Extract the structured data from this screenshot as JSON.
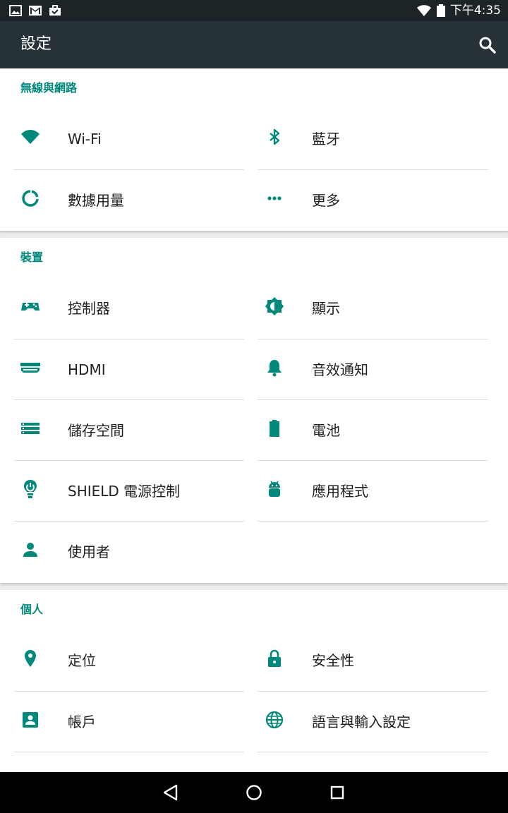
{
  "status_bar": {
    "time": "下午4:35",
    "left_icons": [
      "image-icon",
      "gmail-icon",
      "shopping-bag-icon"
    ],
    "right_icons": [
      "wifi-icon",
      "battery-icon"
    ]
  },
  "app_bar": {
    "title": "設定",
    "search_icon": "search-icon"
  },
  "sections": [
    {
      "title": "無線與網路",
      "items": [
        {
          "label": "Wi-Fi",
          "icon": "wifi-icon"
        },
        {
          "label": "藍牙",
          "icon": "bluetooth-icon"
        },
        {
          "label": "數據用量",
          "icon": "data-usage-icon"
        },
        {
          "label": "更多",
          "icon": "more-icon"
        }
      ]
    },
    {
      "title": "裝置",
      "items": [
        {
          "label": "控制器",
          "icon": "gamepad-icon"
        },
        {
          "label": "顯示",
          "icon": "brightness-icon"
        },
        {
          "label": "HDMI",
          "icon": "hdmi-icon"
        },
        {
          "label": "音效通知",
          "icon": "bell-icon"
        },
        {
          "label": "儲存空間",
          "icon": "storage-icon"
        },
        {
          "label": "電池",
          "icon": "battery-icon"
        },
        {
          "label": "SHIELD 電源控制",
          "icon": "power-bulb-icon"
        },
        {
          "label": "應用程式",
          "icon": "android-icon"
        },
        {
          "label": "使用者",
          "icon": "person-icon"
        }
      ]
    },
    {
      "title": "個人",
      "items": [
        {
          "label": "定位",
          "icon": "location-icon"
        },
        {
          "label": "安全性",
          "icon": "lock-icon"
        },
        {
          "label": "帳戶",
          "icon": "account-box-icon"
        },
        {
          "label": "語言與輸入設定",
          "icon": "globe-icon"
        }
      ]
    }
  ],
  "nav_bar": {
    "buttons": [
      "back-icon",
      "home-icon",
      "recents-icon"
    ]
  },
  "colors": {
    "accent": "#00897b",
    "app_bar": "#263238",
    "status_bar": "#1c2428",
    "text": "#212121",
    "divider": "#dedede",
    "background": "#ececec"
  }
}
